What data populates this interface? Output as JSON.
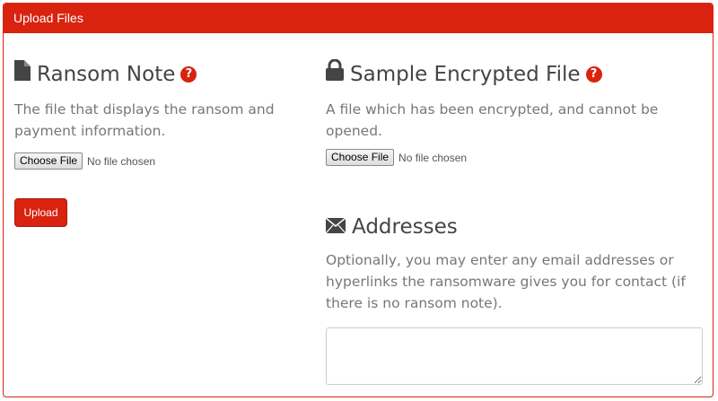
{
  "panel": {
    "title": "Upload Files"
  },
  "ransom_note": {
    "icon": "document-icon",
    "title": "Ransom Note",
    "help_glyph": "?",
    "description": "The file that displays the ransom and payment information.",
    "file_button": "Choose File",
    "file_status": "No file chosen"
  },
  "sample_file": {
    "icon": "lock-icon",
    "title": "Sample Encrypted File",
    "help_glyph": "?",
    "description": "A file which has been encrypted, and cannot be opened.",
    "file_button": "Choose File",
    "file_status": "No file chosen"
  },
  "upload": {
    "label": "Upload"
  },
  "addresses": {
    "icon": "envelope-icon",
    "title": "Addresses",
    "description": "Optionally, you may enter any email addresses or hyperlinks the ransomware gives you for contact (if there is no ransom note).",
    "textarea_value": ""
  },
  "colors": {
    "accent": "#d9230f",
    "heading_text": "#444444",
    "body_text": "#777777"
  }
}
